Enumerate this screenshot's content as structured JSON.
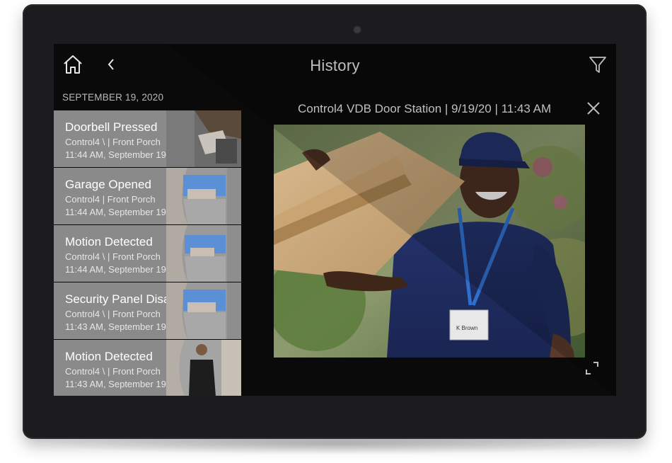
{
  "header": {
    "title": "History",
    "home_icon": "home-icon",
    "back_icon": "chevron-left-icon",
    "filter_icon": "filter-icon"
  },
  "list": {
    "date_header": "SEPTEMBER 19, 2020",
    "events": [
      {
        "title": "Doorbell Pressed",
        "source": "Control4 \\  |  Front Porch",
        "time": "11:44 AM, September 19"
      },
      {
        "title": "Garage Opened",
        "source": "Control4  |  Front Porch",
        "time": "11:44 AM, September 19"
      },
      {
        "title": "Motion Detected",
        "source": "Control4 \\  |  Front Porch",
        "time": "11:44 AM, September 19"
      },
      {
        "title": "Security Panel Disarmed",
        "source": "Control4 \\  |  Front Porch",
        "time": "11:43 AM, September 19"
      },
      {
        "title": "Motion Detected",
        "source": "Control4 \\  |  Front Porch",
        "time": "11:43 AM, September 19"
      }
    ]
  },
  "detail": {
    "caption": "Control4 VDB Door Station | 9/19/20 | 11:43 AM",
    "close_icon": "close-icon",
    "expand_icon": "expand-icon",
    "badge_text": "K Brown"
  },
  "colors": {
    "bezel": "#1c1c1e",
    "screen": "#0a0a0a",
    "row_bg": "#8a8a8a",
    "text": "#e8e8e8"
  }
}
